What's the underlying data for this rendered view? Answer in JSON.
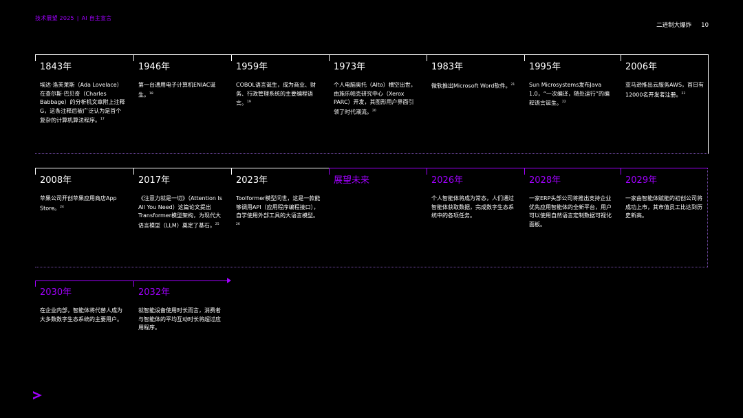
{
  "header": {
    "report_title": "技术展望 2025",
    "section_title": "AI 自主宣言",
    "chapter_title": "二进制大爆炸",
    "page_number": "10"
  },
  "timeline": {
    "row1": [
      {
        "year": "1843年",
        "text": "埃达·洛芙莱斯（Ada Lovelace）在查尔斯·巴贝奇（Charles Babbage）的分析机文章附上注释G，这条注释后被广泛认为是首个复杂的计算机算法程序。",
        "ref": "17"
      },
      {
        "year": "1946年",
        "text": "第一台通用电子计算机ENIAC诞生。",
        "ref": "18"
      },
      {
        "year": "1959年",
        "text": "COBOL语言诞生，成为商业、财务、行政管理系统的主要编程语言。",
        "ref": "19"
      },
      {
        "year": "1973年",
        "text": "个人电脑奥托（Alto）横空出世，由施乐帕克研究中心（Xerox PARC）开发，其图形用户界面引领了时代潮流。",
        "ref": "20"
      },
      {
        "year": "1983年",
        "text": "微软推出Microsoft Word软件。",
        "ref": "21"
      },
      {
        "year": "1995年",
        "text": "Sun Microsystems发布Java 1.0，“一次编译，随处运行”的编程语言诞生。",
        "ref": "22"
      },
      {
        "year": "2006年",
        "text": "亚马逊推出云服务AWS，首日有12000名开发者注册。",
        "ref": "23"
      }
    ],
    "row2": [
      {
        "year": "2008年",
        "text": "苹果公司开创苹果应用商店App Store。",
        "ref": "24"
      },
      {
        "year": "2017年",
        "text": "《注意力就是一切》（Attention Is All You Need）这篇论文提出Transformer模型架构，为现代大语言模型（LLM）奠定了基石。",
        "ref": "25"
      },
      {
        "year": "2023年",
        "text": "Toolformer模型问世，这是一款能够调用API（应用程序编程接口），自学使用外部工具的大语言模型。",
        "ref": "26"
      },
      {
        "year": "展望未来",
        "text": "",
        "ref": ""
      },
      {
        "year": "2026年",
        "text": "个人智能体将成为常态，人们通过智能体获取数据，完成数字生态系统中的各项任务。",
        "ref": ""
      },
      {
        "year": "2028年",
        "text": "一家ERP头部公司将推出支持企业优先应用智能体的全新平台，用户可以使用自然语言定制数据可视化面板。",
        "ref": ""
      },
      {
        "year": "2029年",
        "text": "一家由智能体赋能的初创公司将成功上市，其市值员工比达到历史新高。",
        "ref": ""
      }
    ],
    "row3": [
      {
        "year": "2030年",
        "text": "在企业内部，智能体将代替人成为大多数数字生态系统的主要用户。",
        "ref": ""
      },
      {
        "year": "2032年",
        "text": "就智能设备使用时长而言，消费者与智能体的平均互动时长将超过应用程序。",
        "ref": ""
      }
    ]
  },
  "colors": {
    "accent": "#a100ff",
    "background": "#000000",
    "text": "#ffffff"
  },
  "logo_icon": "greater-than-chevron-icon"
}
